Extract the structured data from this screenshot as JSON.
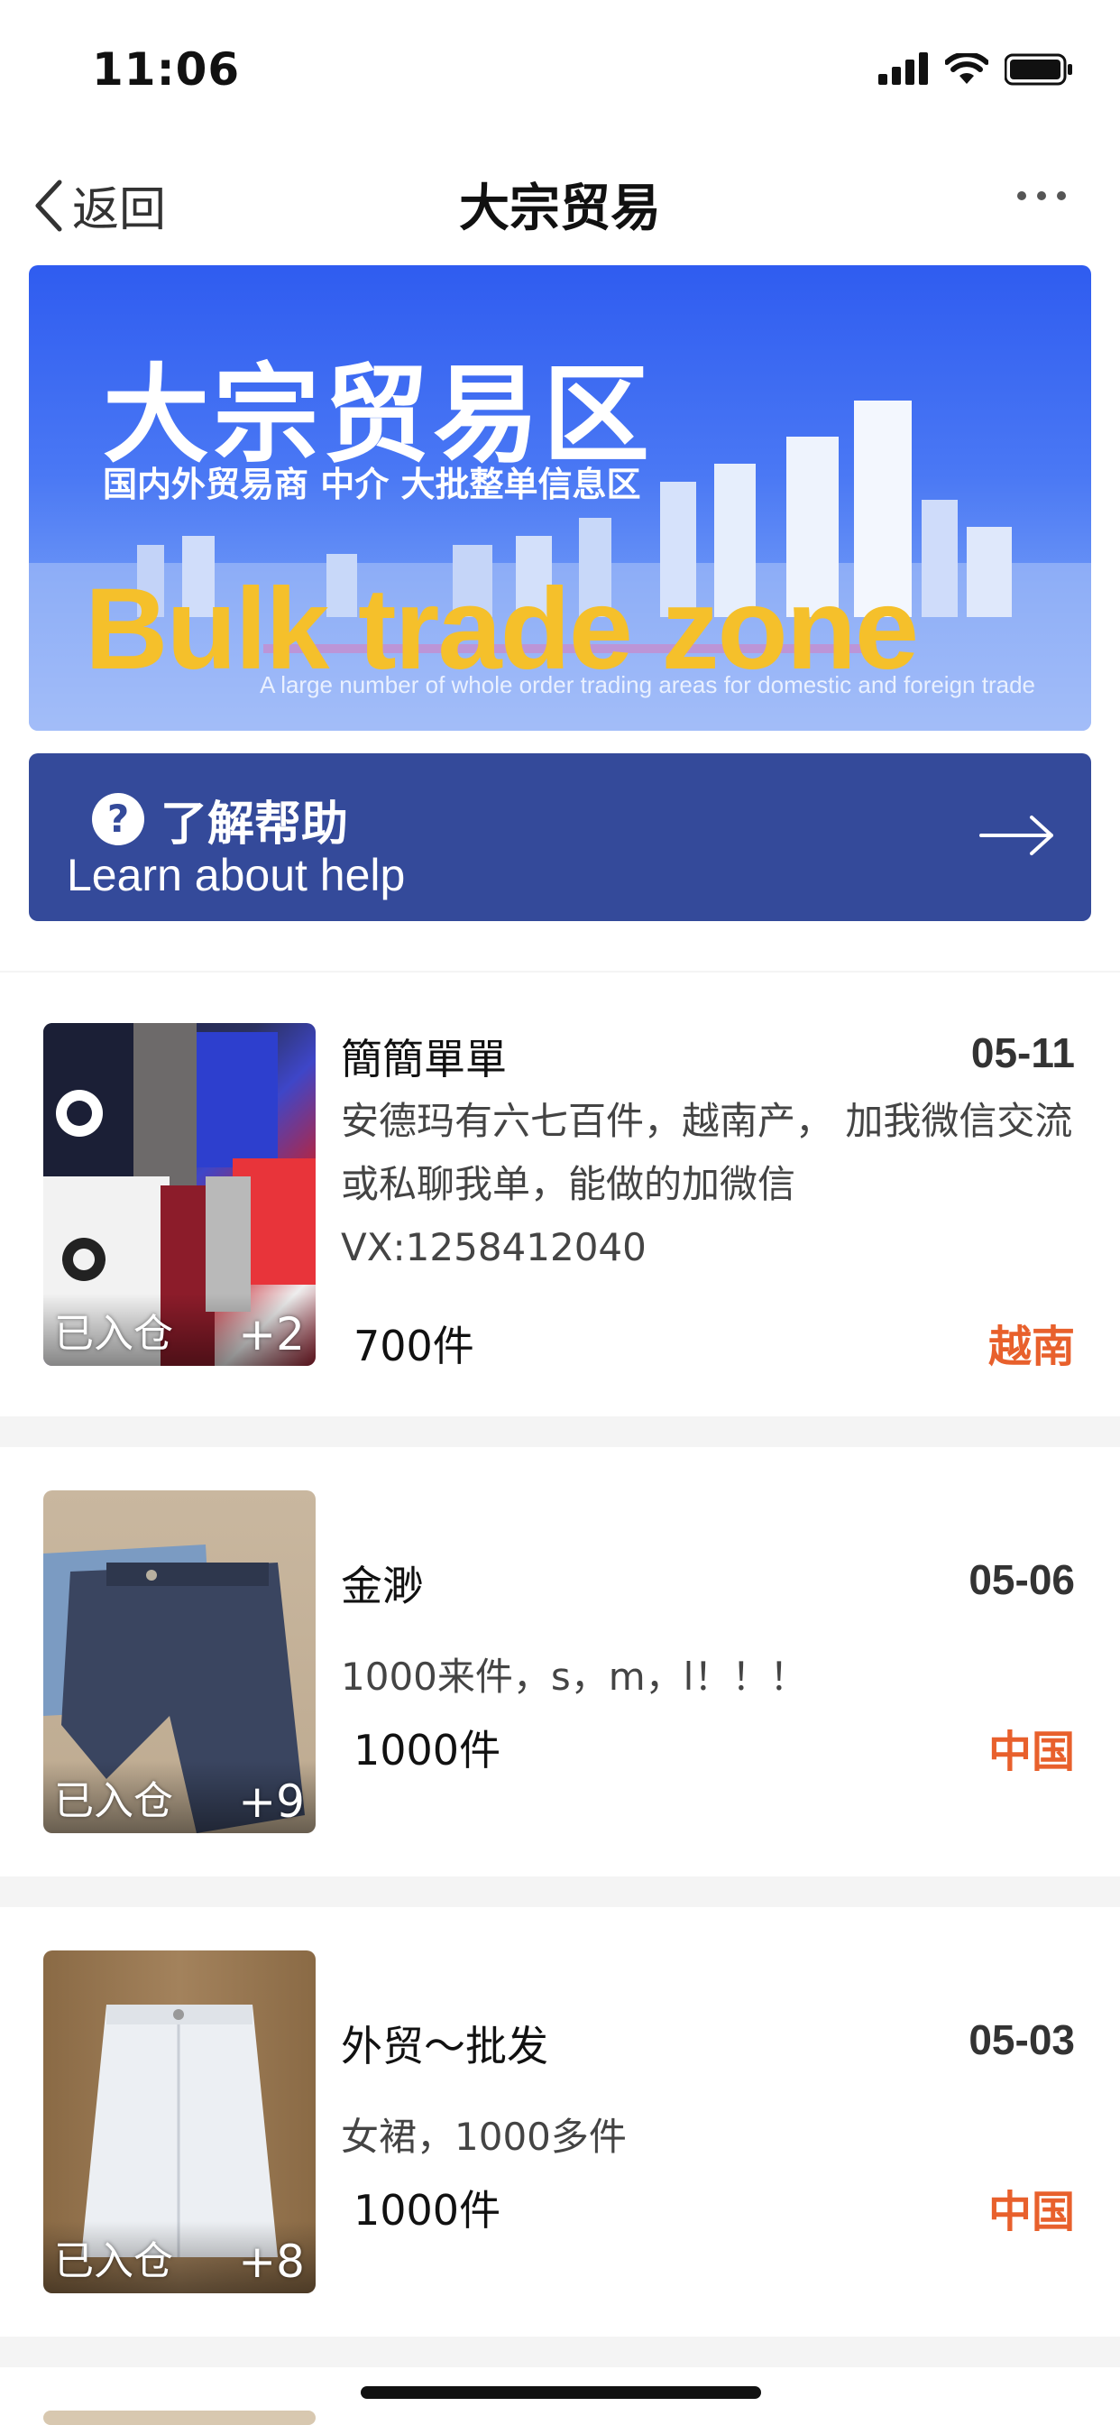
{
  "status_bar": {
    "time": "11:06"
  },
  "nav": {
    "back_label": "返回",
    "title": "大宗贸易"
  },
  "banner": {
    "title": "大宗贸易区",
    "subtitle": "国内外贸易商 中介 大批整单信息区",
    "english_title": "Bulk trade zone",
    "english_sub": "A large number of whole order trading areas for domestic and foreign trade"
  },
  "help": {
    "title": "了解帮助",
    "subtitle": "Learn about help"
  },
  "listings": [
    {
      "name": "簡簡單單",
      "date": "05-11",
      "desc": "安德玛有六七百件，越南产， 加我微信交流或私聊我单，能做的加微信",
      "contact": "VX:1258412040",
      "qty": "700件",
      "origin": "越南",
      "badge": "已入仓",
      "count": "+2"
    },
    {
      "name": "金渺",
      "date": "05-06",
      "desc": "1000来件，s，m，l！！！",
      "qty": "1000件",
      "origin": "中国",
      "badge": "已入仓",
      "count": "+9"
    },
    {
      "name": "外贸～批发",
      "date": "05-03",
      "desc": "女裙，1000多件",
      "qty": "1000件",
      "origin": "中国",
      "badge": "已入仓",
      "count": "+8"
    }
  ]
}
